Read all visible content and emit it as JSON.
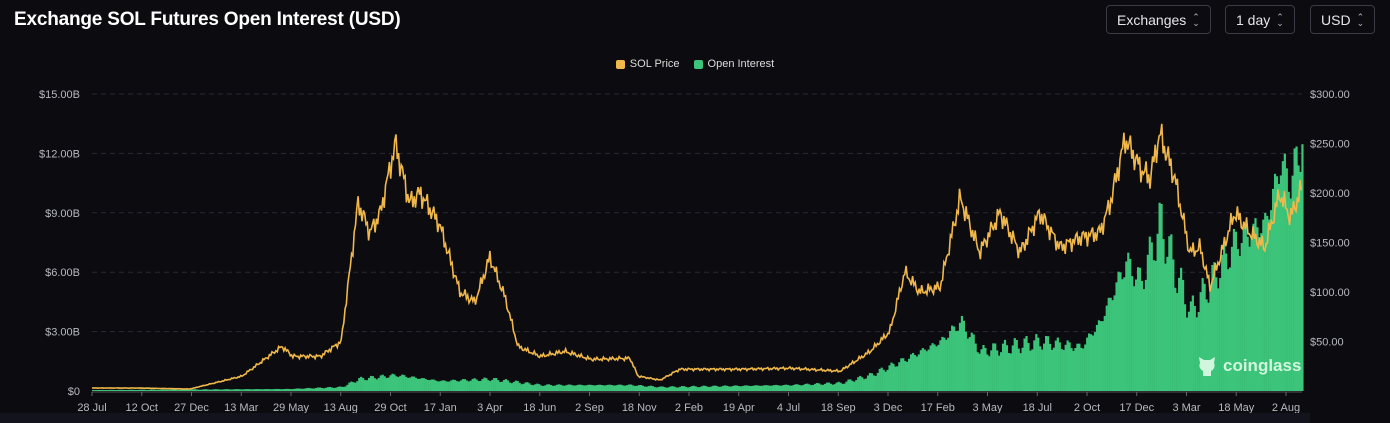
{
  "header": {
    "title": "Exchange SOL Futures Open Interest (USD)",
    "selectors": [
      {
        "label": "Exchanges"
      },
      {
        "label": "1 day"
      },
      {
        "label": "USD"
      }
    ]
  },
  "watermark": "coinglass",
  "colors": {
    "price": "#f0b84a",
    "oi": "#3cc47a",
    "grid": "#2a2b33"
  },
  "chart_data": {
    "type": "line+area",
    "title": "Exchange SOL Futures Open Interest (USD)",
    "legend": [
      {
        "name": "SOL Price",
        "color": "#f0b84a"
      },
      {
        "name": "Open Interest",
        "color": "#3cc47a"
      }
    ],
    "legend_position": "top-center",
    "x_unit": "days since 28 Jul 2020",
    "x_range": [
      0,
      1855
    ],
    "x_ticks": [
      "28 Jul",
      "12 Oct",
      "27 Dec",
      "13 Mar",
      "29 May",
      "13 Aug",
      "29 Oct",
      "17 Jan",
      "3 Apr",
      "18 Jun",
      "2 Sep",
      "18 Nov",
      "2 Feb",
      "19 Apr",
      "4 Jul",
      "18 Sep",
      "3 Dec",
      "17 Feb",
      "3 May",
      "18 Jul",
      "2 Oct",
      "17 Dec",
      "3 Mar",
      "18 May",
      "2 Aug"
    ],
    "y_left": {
      "label": "Open Interest (USD)",
      "range": [
        0,
        15
      ],
      "ticks": [
        "$0",
        "$3.00B",
        "$6.00B",
        "$9.00B",
        "$12.00B",
        "$15.00B"
      ]
    },
    "y_right": {
      "label": "SOL Price",
      "range": [
        0,
        300
      ],
      "ticks": [
        "$50.00",
        "$100.00",
        "$150.00",
        "$200.00",
        "$250.00",
        "$300.00"
      ]
    },
    "grid": true,
    "series": [
      {
        "name": "SOL Price",
        "axis": "right",
        "points": [
          [
            0,
            3
          ],
          [
            72,
            3
          ],
          [
            150,
            2
          ],
          [
            230,
            15
          ],
          [
            291,
            45
          ],
          [
            308,
            35
          ],
          [
            350,
            35
          ],
          [
            382,
            50
          ],
          [
            408,
            190
          ],
          [
            426,
            160
          ],
          [
            442,
            180
          ],
          [
            465,
            250
          ],
          [
            487,
            190
          ],
          [
            503,
            200
          ],
          [
            533,
            168
          ],
          [
            564,
            100
          ],
          [
            587,
            90
          ],
          [
            610,
            135
          ],
          [
            633,
            95
          ],
          [
            653,
            45
          ],
          [
            687,
            35
          ],
          [
            725,
            40
          ],
          [
            765,
            32
          ],
          [
            825,
            33
          ],
          [
            837,
            15
          ],
          [
            871,
            11
          ],
          [
            901,
            22
          ],
          [
            993,
            22
          ],
          [
            1070,
            23
          ],
          [
            1147,
            20
          ],
          [
            1193,
            40
          ],
          [
            1223,
            60
          ],
          [
            1246,
            120
          ],
          [
            1269,
            100
          ],
          [
            1300,
            105
          ],
          [
            1331,
            195
          ],
          [
            1361,
            140
          ],
          [
            1392,
            180
          ],
          [
            1423,
            140
          ],
          [
            1453,
            180
          ],
          [
            1484,
            145
          ],
          [
            1515,
            155
          ],
          [
            1545,
            160
          ],
          [
            1561,
            190
          ],
          [
            1584,
            255
          ],
          [
            1607,
            225
          ],
          [
            1622,
            215
          ],
          [
            1637,
            260
          ],
          [
            1660,
            215
          ],
          [
            1683,
            140
          ],
          [
            1699,
            145
          ],
          [
            1714,
            105
          ],
          [
            1752,
            180
          ],
          [
            1775,
            160
          ],
          [
            1798,
            145
          ],
          [
            1821,
            200
          ],
          [
            1837,
            175
          ],
          [
            1855,
            205
          ]
        ]
      },
      {
        "name": "Open Interest",
        "axis": "left",
        "unit": "B USD",
        "points": [
          [
            0,
            0.05
          ],
          [
            300,
            0.1
          ],
          [
            382,
            0.2
          ],
          [
            408,
            0.6
          ],
          [
            465,
            0.8
          ],
          [
            533,
            0.5
          ],
          [
            610,
            0.6
          ],
          [
            687,
            0.3
          ],
          [
            825,
            0.3
          ],
          [
            871,
            0.2
          ],
          [
            1070,
            0.3
          ],
          [
            1147,
            0.4
          ],
          [
            1193,
            0.8
          ],
          [
            1246,
            1.6
          ],
          [
            1300,
            2.5
          ],
          [
            1331,
            3.5
          ],
          [
            1361,
            2.0
          ],
          [
            1453,
            2.5
          ],
          [
            1515,
            2.2
          ],
          [
            1545,
            3.5
          ],
          [
            1584,
            6.5
          ],
          [
            1607,
            5.5
          ],
          [
            1637,
            8.5
          ],
          [
            1660,
            6.0
          ],
          [
            1683,
            4.0
          ],
          [
            1714,
            5.5
          ],
          [
            1752,
            7.5
          ],
          [
            1775,
            8.0
          ],
          [
            1798,
            8.5
          ],
          [
            1821,
            11.5
          ],
          [
            1837,
            10.5
          ],
          [
            1855,
            13.0
          ]
        ]
      }
    ]
  }
}
